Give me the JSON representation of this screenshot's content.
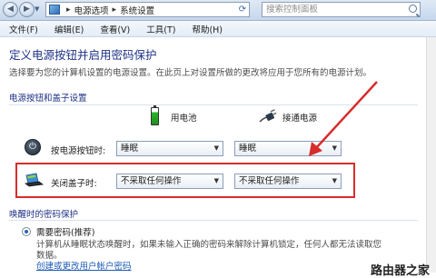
{
  "address_bar": {
    "breadcrumbs": [
      "电源选项",
      "系统设置"
    ],
    "search_placeholder": "搜索控制面板"
  },
  "menu": [
    "文件(F)",
    "编辑(E)",
    "查看(V)",
    "工具(T)",
    "帮助(H)"
  ],
  "page": {
    "title": "定义电源按钮并启用密码保护",
    "description": "选择要为您的计算机设置的电源设置。在此页上对设置所做的更改将应用于您所有的电源计划。"
  },
  "power_section": {
    "heading": "电源按钮和盖子设置",
    "col_battery": "用电池",
    "col_plugged": "接通电源",
    "power_button": {
      "label": "按电源按钮时:",
      "battery": "睡眠",
      "plugged": "睡眠"
    },
    "lid": {
      "label": "关闭盖子时:",
      "battery": "不采取任何操作",
      "plugged": "不采取任何操作"
    }
  },
  "wake_section": {
    "heading": "唤醒时的密码保护",
    "option": "需要密码(推荐)",
    "detail_line1": "计算机从睡眠状态唤醒时，如果未输入正确的密码来解除计算机锁定，任何人都无法读取您",
    "detail_line2": "数据。",
    "link": "创建或更改用户帐户密码"
  },
  "watermark": "路由器之家",
  "colors": {
    "title_blue": "#1e3287",
    "highlight_red": "#d62c2c",
    "link_blue": "#1e5bb5"
  }
}
